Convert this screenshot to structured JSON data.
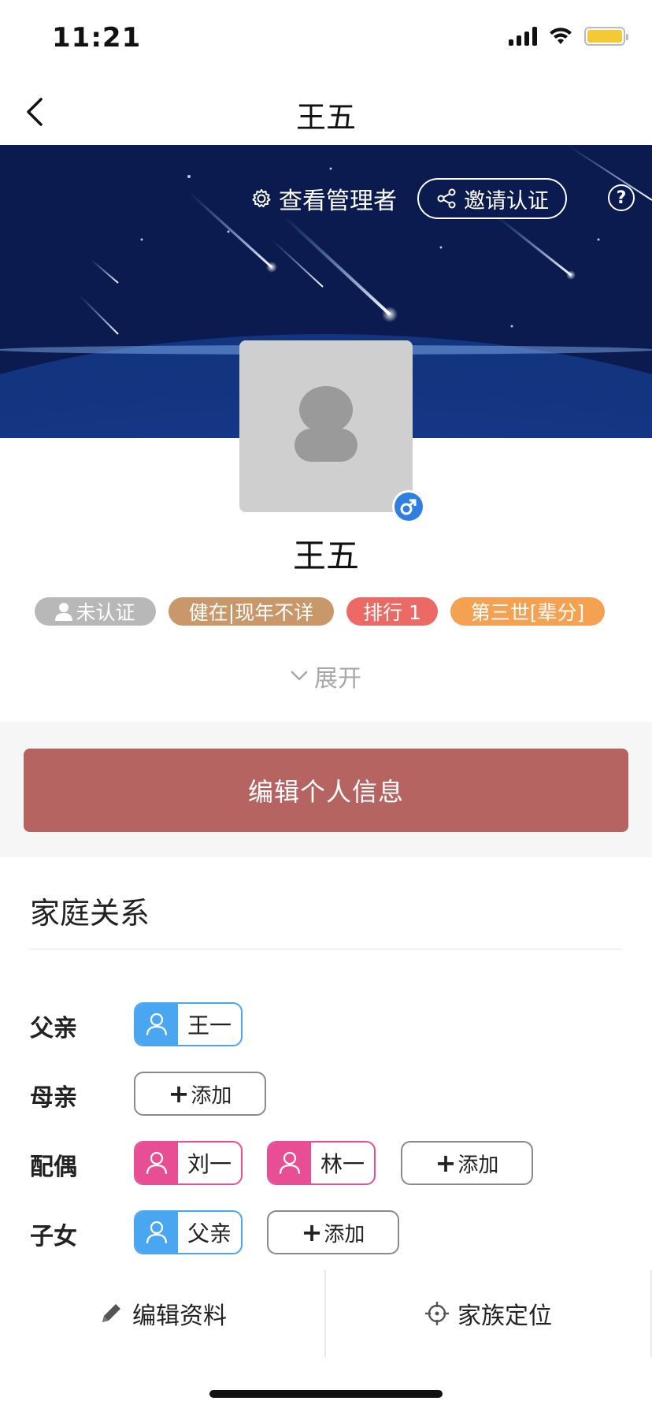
{
  "status_bar": {
    "time": "11:21",
    "signal_icon": "signal-icon",
    "wifi_icon": "wifi-icon",
    "battery_icon": "battery-icon",
    "battery_color": "#f5c935"
  },
  "nav": {
    "title": "王五",
    "back_icon": "back-arrow-icon"
  },
  "banner": {
    "view_admin_label": "查看管理者",
    "invite_label": "邀请认证",
    "help_label": "?"
  },
  "profile": {
    "name": "王五",
    "gender": "male",
    "tags": {
      "auth": "未认证",
      "alive": "健在|现年不详",
      "rank": "排行 1",
      "generation": "第三世[辈分]"
    },
    "expand_label": "展开"
  },
  "edit_button_label": "编辑个人信息",
  "family": {
    "title": "家庭关系",
    "father": {
      "label": "父亲",
      "members": [
        "王一"
      ]
    },
    "mother": {
      "label": "母亲",
      "members": []
    },
    "spouse": {
      "label": "配偶",
      "members": [
        "刘一",
        "林一"
      ]
    },
    "children": {
      "label": "子女",
      "members": [
        "父亲"
      ]
    },
    "add_label": "添加"
  },
  "bottom_bar": {
    "edit_profile_label": "编辑资料",
    "family_locate_label": "家族定位"
  },
  "colors": {
    "primary": "#b66462",
    "male": "#4ba6f2",
    "female": "#e84e94",
    "tag_auth": "#b8b8b8",
    "tag_alive": "#c8976a",
    "tag_rank": "#ec6a66",
    "tag_generation": "#f4a251"
  }
}
